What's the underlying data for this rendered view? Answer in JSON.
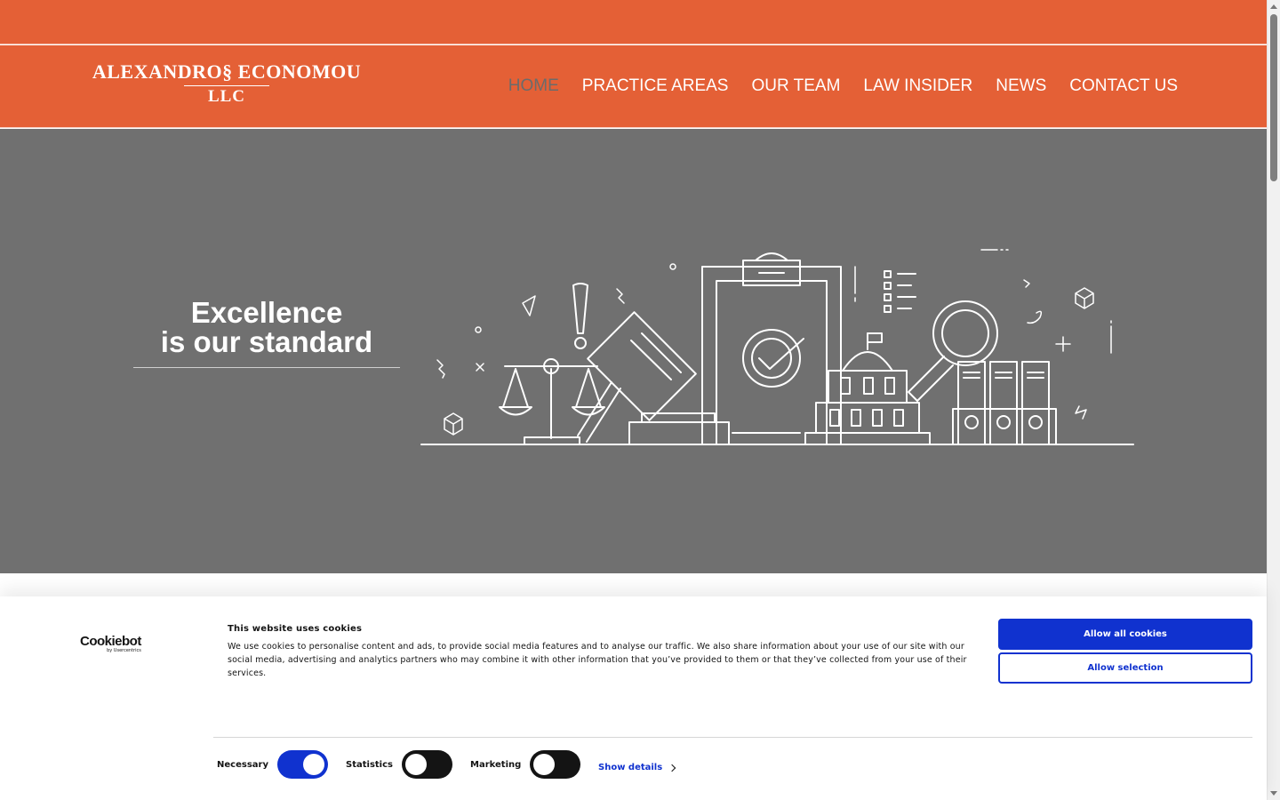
{
  "brand": {
    "line1": "ALEXANDRO§ ECONOMOU",
    "line2": "LLC",
    "color": "#e46036"
  },
  "nav": {
    "items": [
      {
        "label": "HOME",
        "active": true
      },
      {
        "label": "PRACTICE AREAS"
      },
      {
        "label": "OUR TEAM"
      },
      {
        "label": "LAW INSIDER"
      },
      {
        "label": "NEWS"
      },
      {
        "label": "CONTACT US"
      }
    ]
  },
  "hero": {
    "line1": "Excellence",
    "line2": "is our standard",
    "background": "#707070",
    "illustration": "legal-line-art-illustration"
  },
  "cookie": {
    "logo_main": "Cookiebot",
    "logo_sub": "by Usercentrics",
    "title": "This website uses cookies",
    "body": "We use cookies to personalise content and ads, to provide social media features and to analyse our traffic. We also share information about your use of our site with our social media, advertising and analytics partners who may combine it with other information that you’ve provided to them or that they’ve collected from your use of their services.",
    "allow_all": "Allow all cookies",
    "allow_selection": "Allow selection",
    "toggles": [
      {
        "label": "Necessary",
        "on": true
      },
      {
        "label": "Statistics",
        "on": false
      },
      {
        "label": "Marketing",
        "on": false
      }
    ],
    "show_details": "Show details",
    "accent": "#1032cf"
  }
}
